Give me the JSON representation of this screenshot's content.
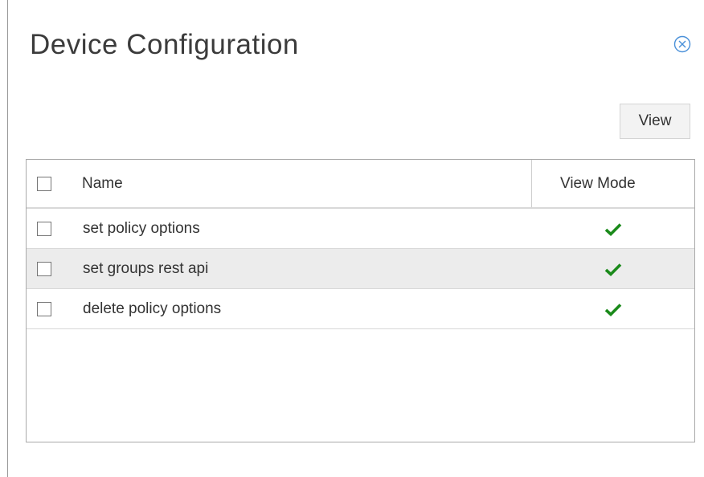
{
  "dialog": {
    "title": "Device Configuration",
    "close_icon": "close-circle-icon"
  },
  "toolbar": {
    "view_label": "View"
  },
  "table": {
    "columns": [
      "Name",
      "View Mode"
    ],
    "rows": [
      {
        "name": "set policy options",
        "view_mode": true
      },
      {
        "name": "set groups rest api",
        "view_mode": true
      },
      {
        "name": "delete policy options",
        "view_mode": true
      }
    ]
  },
  "colors": {
    "check": "#1a8a1a",
    "close_icon": "#4a90d9",
    "row_alt": "#ececec"
  }
}
